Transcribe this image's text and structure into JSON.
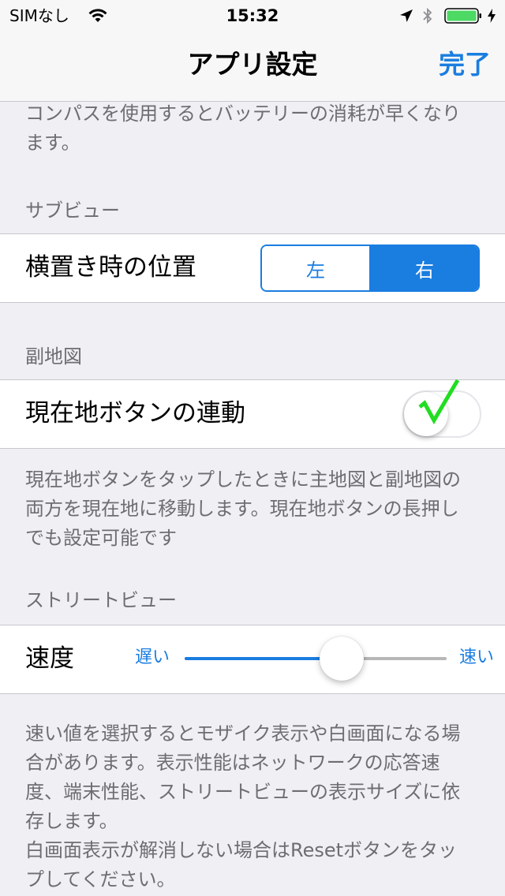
{
  "status_bar": {
    "carrier": "SIMなし",
    "time": "15:32",
    "icons": [
      "wifi-icon",
      "location-arrow-icon",
      "bluetooth-icon",
      "battery-icon",
      "charging-bolt-icon"
    ],
    "battery_color": "#4cd964"
  },
  "nav": {
    "title": "アプリ設定",
    "done_label": "完了"
  },
  "compass_footer": "コンパスを使用するとバッテリーの消耗が早くなり\nます。",
  "subview": {
    "header": "サブビュー",
    "row_label": "横置き時の位置",
    "segments": [
      "左",
      "右"
    ],
    "selected": "右"
  },
  "submap": {
    "header": "副地図",
    "row_label": "現在地ボタンの連動",
    "toggle_on": false,
    "footer": "現在地ボタンをタップしたときに主地図と副地図の\n両方を現在地に移動します。現在地ボタンの長押し\nでも設定可能です"
  },
  "streetview": {
    "header": "ストリートビュー",
    "row_label": "速度",
    "min_label": "遅い",
    "max_label": "速い",
    "slider_value": 0.6,
    "footer": "速い値を選択するとモザイク表示や白画面になる場\n合があります。表示性能はネットワークの応答速\n度、端末性能、ストリートビューの表示サイズに依\n存します。\n白画面表示が解消しない場合はResetボタンをタッ\nプしてください。"
  },
  "colors": {
    "accent": "#1a7de0",
    "check_mark": "#22dd22",
    "background": "#efeff4",
    "secondary_text": "#6d6d72"
  }
}
